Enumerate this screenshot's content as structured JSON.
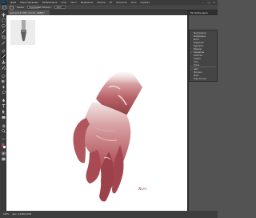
{
  "menubar": {
    "logo": "Ps",
    "items": [
      "Файл",
      "Редактирование",
      "Изображение",
      "Слои",
      "Текст",
      "Выделение",
      "Фильтр",
      "3D",
      "Просмотр",
      "Окно",
      "Справка"
    ],
    "window_controls": [
      "–",
      "□",
      "×"
    ]
  },
  "optionsbar": {
    "mode_label": "Режим:",
    "mode_value": "Нормальный",
    "opacity_label": "Непрозр.:",
    "opacity_value": "100%"
  },
  "document": {
    "tab_title": "ушкл.psd @ 100% (Слой 1, RGB/8) *"
  },
  "panel": {
    "title": "Настройки цвета",
    "items": [
      {
        "label": "Инструменты",
        "checked": false
      },
      {
        "label": "Информация",
        "checked": false
      },
      {
        "label": "Кисти",
        "checked": false
      },
      {
        "label": "Коррекция",
        "checked": false
      },
      {
        "label": "Навигатор",
        "checked": false
      },
      {
        "label": "Образцы",
        "checked": false
      },
      {
        "label": "Параметры",
        "checked": true
      },
      {
        "label": "Свойства",
        "checked": false
      },
      {
        "label": "Символ",
        "checked": false
      },
      {
        "label": "Слои",
        "checked": false
      },
      {
        "label": "Стили",
        "checked": false
      },
      {
        "label": "Цвет",
        "checked": true
      },
      {
        "label": "Протокол",
        "checked": false
      },
      {
        "label": "Abzac",
        "checked": false
      },
      {
        "label": "Корр. Контур",
        "checked": false
      }
    ]
  },
  "statusbar": {
    "zoom": "100%",
    "doc_size": "Док: 2,29М/3,05М"
  },
  "signature": "Коч",
  "colors": {
    "menubar_bg": "#3b3b3b",
    "canvas_bg": "#ffffff",
    "skin_dark": "#9c4a50",
    "skin_light": "#e6c8c7",
    "signature": "#a22633"
  },
  "icons": [
    "move-icon",
    "marquee-icon",
    "lasso-icon",
    "magic-wand-icon",
    "crop-icon",
    "eyedropper-icon",
    "healing-icon",
    "brush-icon",
    "stamp-icon",
    "history-brush-icon",
    "eraser-icon",
    "gradient-icon",
    "blur-icon",
    "dodge-icon",
    "pen-icon",
    "type-icon",
    "path-select-icon",
    "shape-icon",
    "hand-icon",
    "zoom-icon"
  ]
}
